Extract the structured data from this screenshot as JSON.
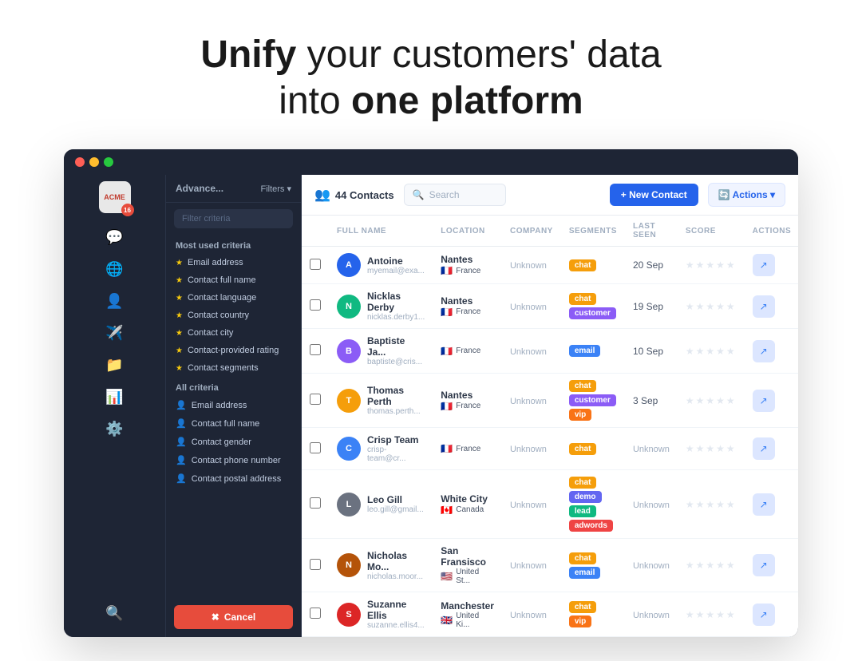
{
  "headline": {
    "part1": "Unify",
    "part2": " your customers' data",
    "part3": "into ",
    "part4": "one platform"
  },
  "titlebar": {
    "dots": [
      "red",
      "yellow",
      "green"
    ]
  },
  "sidebar": {
    "logo": "ACME",
    "badge": "16",
    "icons": [
      "💬",
      "🌐",
      "👤",
      "✈️",
      "📁",
      "📊",
      "⚙️",
      "🔍"
    ]
  },
  "filter_panel": {
    "title": "Advance...",
    "filter_btn": "Filters ▾",
    "search_placeholder": "Filter criteria",
    "most_used_title": "Most used criteria",
    "most_used_items": [
      "Email address",
      "Contact full name",
      "Contact language",
      "Contact country",
      "Contact city",
      "Contact-provided rating",
      "Contact segments"
    ],
    "all_criteria_title": "All criteria",
    "all_criteria_items": [
      "Email address",
      "Contact full name",
      "Contact gender",
      "Contact phone number",
      "Contact postal address"
    ],
    "cancel_label": "Cancel"
  },
  "main_header": {
    "contacts_icon": "👥",
    "contacts_count": "44 Contacts",
    "search_placeholder": "Search",
    "new_contact_label": "+ New Contact",
    "actions_label": "🔄 Actions ▾"
  },
  "table": {
    "columns": [
      "",
      "FULL NAME",
      "LOCATION",
      "COMPANY",
      "SEGMENTS",
      "LAST SEEN",
      "SCORE",
      "ACTIONS"
    ],
    "rows": [
      {
        "id": 1,
        "name": "Antoine",
        "email": "myemail@exa...",
        "city": "Nantes",
        "country": "France",
        "flag": "🇫🇷",
        "company": "Unknown",
        "segments": [
          "chat"
        ],
        "last_seen": "20 Sep",
        "avatar_color": "#2563eb",
        "avatar_letter": "A"
      },
      {
        "id": 2,
        "name": "Nicklas Derby",
        "email": "nicklas.derby1...",
        "city": "Nantes",
        "country": "France",
        "flag": "🇫🇷",
        "company": "Unknown",
        "segments": [
          "chat",
          "customer"
        ],
        "last_seen": "19 Sep",
        "avatar_color": "#10b981",
        "avatar_letter": "N"
      },
      {
        "id": 3,
        "name": "Baptiste Ja...",
        "email": "baptiste@cris...",
        "city": "",
        "country": "France",
        "flag": "🇫🇷",
        "company": "Unknown",
        "segments": [
          "email"
        ],
        "last_seen": "10 Sep",
        "avatar_color": "#8b5cf6",
        "avatar_letter": "B"
      },
      {
        "id": 4,
        "name": "Thomas Perth",
        "email": "thomas.perth...",
        "city": "Nantes",
        "country": "France",
        "flag": "🇫🇷",
        "company": "Unknown",
        "segments": [
          "chat",
          "customer",
          "vip"
        ],
        "last_seen": "3 Sep",
        "avatar_color": "#f59e0b",
        "avatar_letter": "T"
      },
      {
        "id": 5,
        "name": "Crisp Team",
        "email": "crisp-team@cr...",
        "city": "",
        "country": "France",
        "flag": "🇫🇷",
        "company": "Unknown",
        "segments": [
          "chat"
        ],
        "last_seen": "Unknown",
        "avatar_color": "#3b82f6",
        "avatar_letter": "C"
      },
      {
        "id": 6,
        "name": "Leo Gill",
        "email": "leo.gill@gmail...",
        "city": "White City",
        "country": "Canada",
        "flag": "🇨🇦",
        "company": "Unknown",
        "segments": [
          "chat",
          "demo",
          "lead",
          "adwords"
        ],
        "last_seen": "Unknown",
        "avatar_color": "#6b7280",
        "avatar_letter": "L",
        "has_photo": true,
        "photo_color": "#c084fc"
      },
      {
        "id": 7,
        "name": "Nicholas Mo...",
        "email": "nicholas.moor...",
        "city": "San Fransisco",
        "country": "United St...",
        "flag": "🇺🇸",
        "company": "Unknown",
        "segments": [
          "chat",
          "email"
        ],
        "last_seen": "Unknown",
        "avatar_color": "#b45309",
        "avatar_letter": "N",
        "has_photo": true,
        "photo_color": "#92400e"
      },
      {
        "id": 8,
        "name": "Suzanne Ellis",
        "email": "suzanne.ellis4...",
        "city": "Manchester",
        "country": "United Ki...",
        "flag": "🇬🇧",
        "company": "Unknown",
        "segments": [
          "chat",
          "vip"
        ],
        "last_seen": "Unknown",
        "avatar_color": "#dc2626",
        "avatar_letter": "S",
        "has_photo": true,
        "photo_color": "#b91c1c"
      }
    ]
  },
  "colors": {
    "sidebar_bg": "#1e2535",
    "accent_blue": "#2563eb",
    "tag_chat": "#f59e0b",
    "tag_customer": "#8b5cf6",
    "tag_email": "#3b82f6",
    "tag_vip": "#f97316",
    "tag_demo": "#6366f1",
    "tag_lead": "#10b981",
    "tag_adwords": "#ef4444"
  }
}
